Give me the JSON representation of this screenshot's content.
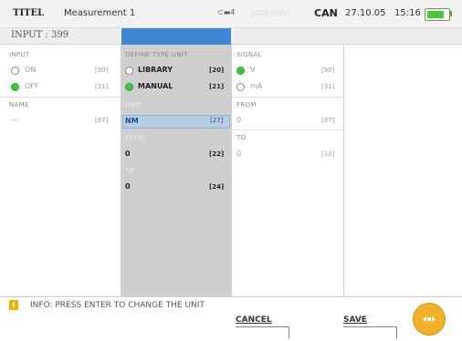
{
  "topbar": {
    "title": "TITEL",
    "measurement": "Measurement 1",
    "key_indicator": "⊂▬4",
    "dim_indicator": "0000 0000",
    "can": "CAN",
    "date": "27.10.05",
    "time": "15:16",
    "battery_level": 0.8
  },
  "input": {
    "label": "INPUT : 399"
  },
  "col1": {
    "input_header": "INPUT",
    "on_label": "ON",
    "on_key": "[30]",
    "off_label": "OFF",
    "off_key": "[31]",
    "name_header": "NAME",
    "name_value": "---",
    "name_key": "[37]"
  },
  "col2": {
    "define_header": "DEFINE TYPE UNIT",
    "library_label": "LIBRARY",
    "library_key": "[20]",
    "manual_label": "MANUAL",
    "manual_key": "[21]",
    "unit_header": "UNIT",
    "unit_value": "NM",
    "unit_key": "[27]",
    "from_header": "FROM",
    "from_value": "0",
    "from_key": "[22]",
    "to_header": "TO",
    "to_value": "0",
    "to_key": "[24]"
  },
  "col3": {
    "signal_header": "SIGNAL",
    "v_label": "V",
    "v_key": "[30]",
    "ma_label": "mA",
    "ma_key": "[31]",
    "from_header": "FROM",
    "from_value": "0",
    "from_key": "[37]",
    "to_header": "TO",
    "to_value": "0",
    "to_key": "[10]"
  },
  "footer": {
    "info_icon": "i",
    "info_text": "INFO: PRESS ENTER TO CHANGE THE UNIT",
    "cancel_label": "CANCEL",
    "save_label": "SAVE"
  },
  "colors": {
    "accent": "#3f86d4",
    "radio_on": "#3cc73c",
    "nav_button": "#f2b12b",
    "info_icon": "#f0b400"
  }
}
